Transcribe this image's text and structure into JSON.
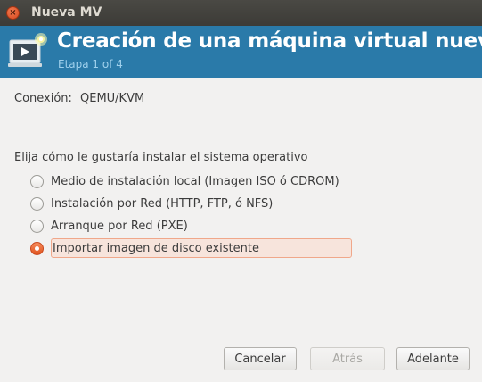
{
  "window": {
    "title": "Nueva MV",
    "close_glyph": "×"
  },
  "header": {
    "title": "Creación de una máquina virtual nueva",
    "subtitle": "Etapa 1 of 4",
    "icon": "vm-new-icon"
  },
  "connection": {
    "label": "Conexión:",
    "value": "QEMU/KVM"
  },
  "install": {
    "prompt": "Elija cómo le gustaría instalar el sistema operativo",
    "options": [
      {
        "label": "Medio de instalación local (Imagen ISO ó CDROM)",
        "selected": false
      },
      {
        "label": "Instalación por Red (HTTP, FTP, ó NFS)",
        "selected": false
      },
      {
        "label": "Arranque por Red (PXE)",
        "selected": false
      },
      {
        "label": "Importar imagen de disco existente",
        "selected": true
      }
    ]
  },
  "buttons": {
    "cancel": "Cancelar",
    "back": "Atrás",
    "forward": "Adelante"
  },
  "colors": {
    "header_bg": "#2a7aa9",
    "accent": "#e0541f",
    "window_bg": "#f2f1f0"
  }
}
